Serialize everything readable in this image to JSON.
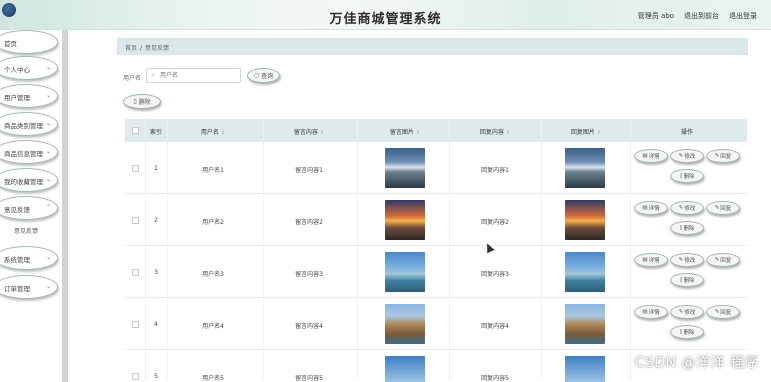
{
  "header": {
    "title": "万佳商城管理系统",
    "admin": "管理员 abo",
    "back_to_front": "退出到前台",
    "logout": "退出登录"
  },
  "sidebar": {
    "items": [
      {
        "label": "首页",
        "caret": ""
      },
      {
        "label": "个人中心",
        "caret": "⌄"
      },
      {
        "label": "用户管理",
        "caret": "⌄"
      },
      {
        "label": "商品类别管理",
        "caret": "⌄"
      },
      {
        "label": "商品信息管理",
        "caret": "⌄"
      },
      {
        "label": "我的收藏管理",
        "caret": "⌄"
      },
      {
        "label": "意见反馈",
        "caret": "⌃"
      },
      {
        "label": "系统管理",
        "caret": "⌄"
      },
      {
        "label": "订单管理",
        "caret": "⌄"
      }
    ],
    "sub_item": "意见反馈"
  },
  "breadcrumb": {
    "home": "首页",
    "sep": "/",
    "current": "意见反馈"
  },
  "search": {
    "label": "用户名",
    "placeholder": "用户名",
    "query_button": "查询",
    "delete_button": "删除"
  },
  "table": {
    "headers": {
      "index": "索引",
      "username": "用户名",
      "message": "留言内容",
      "message_image": "留言图片",
      "reply": "回复内容",
      "reply_image": "回复图片",
      "actions": "操作"
    },
    "rows": [
      {
        "index": "1",
        "username": "用户名1",
        "message": "留言内容1",
        "reply": "回复内容1"
      },
      {
        "index": "2",
        "username": "用户名2",
        "message": "留言内容2",
        "reply": "回复内容2"
      },
      {
        "index": "3",
        "username": "用户名3",
        "message": "留言内容3",
        "reply": "回复内容3"
      },
      {
        "index": "4",
        "username": "用户名4",
        "message": "留言内容4",
        "reply": "回复内容4"
      },
      {
        "index": "5",
        "username": "用户名5",
        "message": "留言内容5",
        "reply": "回复内容5"
      }
    ],
    "actions": {
      "detail": "详情",
      "edit": "修改",
      "reply": "回复",
      "delete": "删除"
    }
  },
  "watermark": "CSDN @洋洋  程序"
}
